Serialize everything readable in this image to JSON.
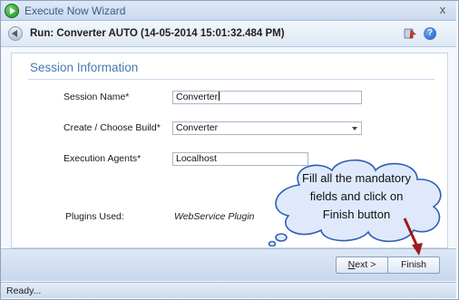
{
  "window": {
    "title": "Execute Now Wizard",
    "close_glyph": "x"
  },
  "header": {
    "run_title": "Run: Converter AUTO (14-05-2014 15:01:32.484 PM)",
    "help_glyph": "?"
  },
  "section": {
    "title": "Session Information"
  },
  "form": {
    "session_name_label": "Session Name*",
    "session_name_value": "Converter",
    "build_label": "Create / Choose Build*",
    "build_value": "Converter",
    "agents_label": "Execution Agents*",
    "agents_value": "Localhost",
    "plugins_label": "Plugins Used:",
    "plugins_value": "WebService Plugin"
  },
  "callout": {
    "line1": "Fill all the mandatory",
    "line2": "fields and click on",
    "line3": "Finish button"
  },
  "buttons": {
    "next_hotkey": "N",
    "next_rest": "ext >",
    "finish": "Finish"
  },
  "status": {
    "text": "Ready..."
  },
  "icons": {
    "app": "play-icon",
    "back": "back-arrow-icon",
    "tool": "tool-icon",
    "help": "help-icon",
    "dropdown": "chevron-down-icon"
  }
}
